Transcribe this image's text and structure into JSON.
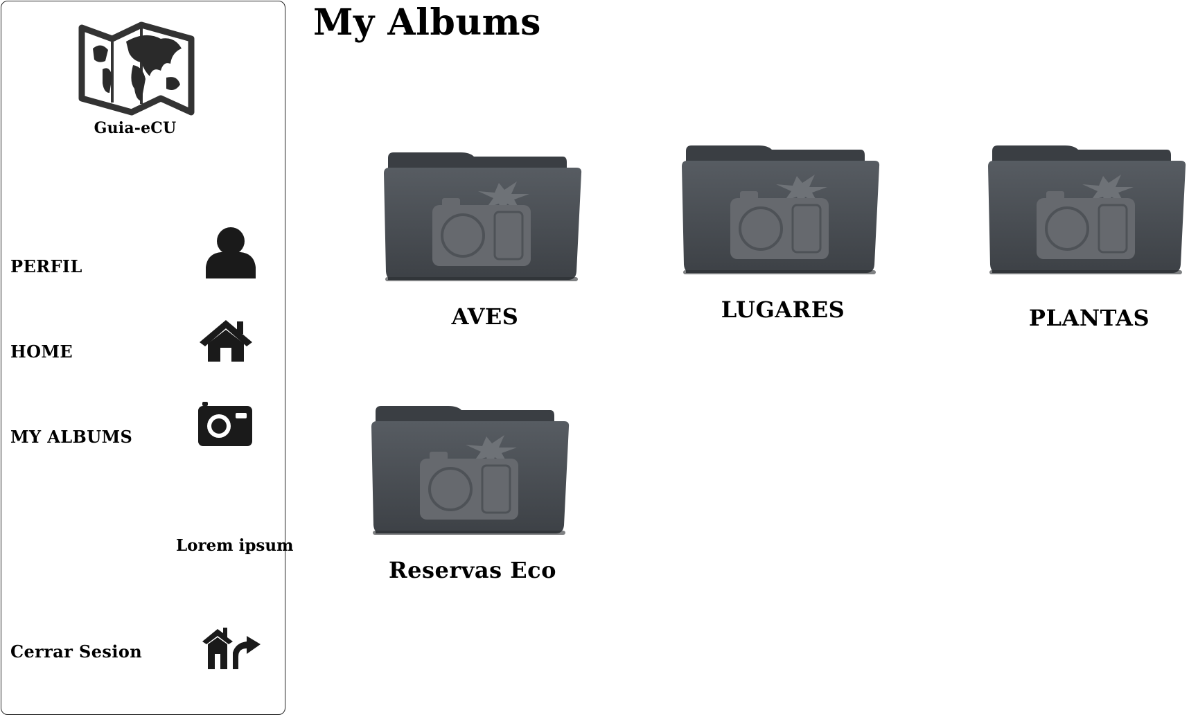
{
  "app": {
    "brand": "Guia-eCU",
    "logo_icon": "world-map-icon"
  },
  "nav": {
    "items": [
      {
        "label": "PERFIL",
        "icon": "user-icon"
      },
      {
        "label": "HOME",
        "icon": "home-icon"
      },
      {
        "label": "MY ALBUMS",
        "icon": "camera-icon"
      }
    ],
    "placeholder_text": "Lorem ipsum",
    "logout": {
      "label": "Cerrar Sesion",
      "icon": "logout-house-arrow-icon"
    }
  },
  "main": {
    "title": "My Albums",
    "albums": [
      {
        "label": "AVES",
        "icon": "photo-folder-icon"
      },
      {
        "label": "LUGARES",
        "icon": "photo-folder-icon"
      },
      {
        "label": "PLANTAS",
        "icon": "photo-folder-icon"
      },
      {
        "label": "Reservas Eco",
        "icon": "photo-folder-icon"
      }
    ]
  },
  "colors": {
    "folder_body": "#4a4f55",
    "folder_back": "#3c4045",
    "folder_emblem": "#676b70",
    "icon": "#1a1a1a"
  }
}
